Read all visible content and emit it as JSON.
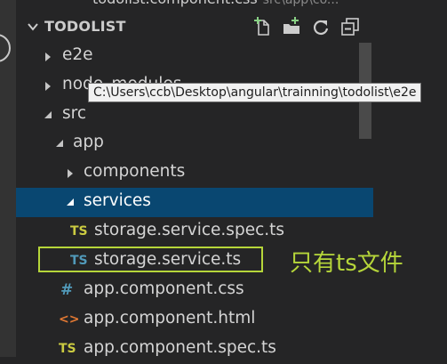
{
  "top_tab": {
    "text": "todolist.component.css",
    "path": "src\\app\\co..."
  },
  "explorer": {
    "title": "TODOLIST",
    "toolbar": {
      "new_file_icon": "new-file-icon",
      "new_folder_icon": "new-folder-icon",
      "refresh_icon": "refresh-icon",
      "collapse_icon": "collapse-all-icon"
    },
    "tree": [
      {
        "label": "e2e",
        "kind": "folder",
        "expanded": false,
        "depth": 0
      },
      {
        "label": "node_modules",
        "kind": "folder",
        "expanded": false,
        "depth": 0
      },
      {
        "label": "src",
        "kind": "folder",
        "expanded": true,
        "depth": 0
      },
      {
        "label": "app",
        "kind": "folder",
        "expanded": true,
        "depth": 1
      },
      {
        "label": "components",
        "kind": "folder",
        "expanded": false,
        "depth": 2
      },
      {
        "label": "services",
        "kind": "folder",
        "expanded": true,
        "depth": 2,
        "selected": true
      },
      {
        "label": "storage.service.spec.ts",
        "kind": "file",
        "badge": "TS",
        "badge_color": "#cbcb41",
        "depth": 3
      },
      {
        "label": "storage.service.ts",
        "kind": "file",
        "badge": "TS",
        "badge_color": "#519aba",
        "depth": 3
      },
      {
        "label": "app.component.css",
        "kind": "file",
        "badge": "#",
        "badge_color": "#519aba",
        "depth": 2
      },
      {
        "label": "app.component.html",
        "kind": "file",
        "badge": "<>",
        "badge_color": "#e37933",
        "depth": 2
      },
      {
        "label": "app.component.spec.ts",
        "kind": "file",
        "badge": "TS",
        "badge_color": "#cbcb41",
        "depth": 2
      }
    ]
  },
  "tooltip": {
    "text": "C:\\Users\\ccb\\Desktop\\angular\\trainning\\todolist\\e2e"
  },
  "annotation": {
    "text": "只有ts文件",
    "color": "#b6d63a"
  }
}
